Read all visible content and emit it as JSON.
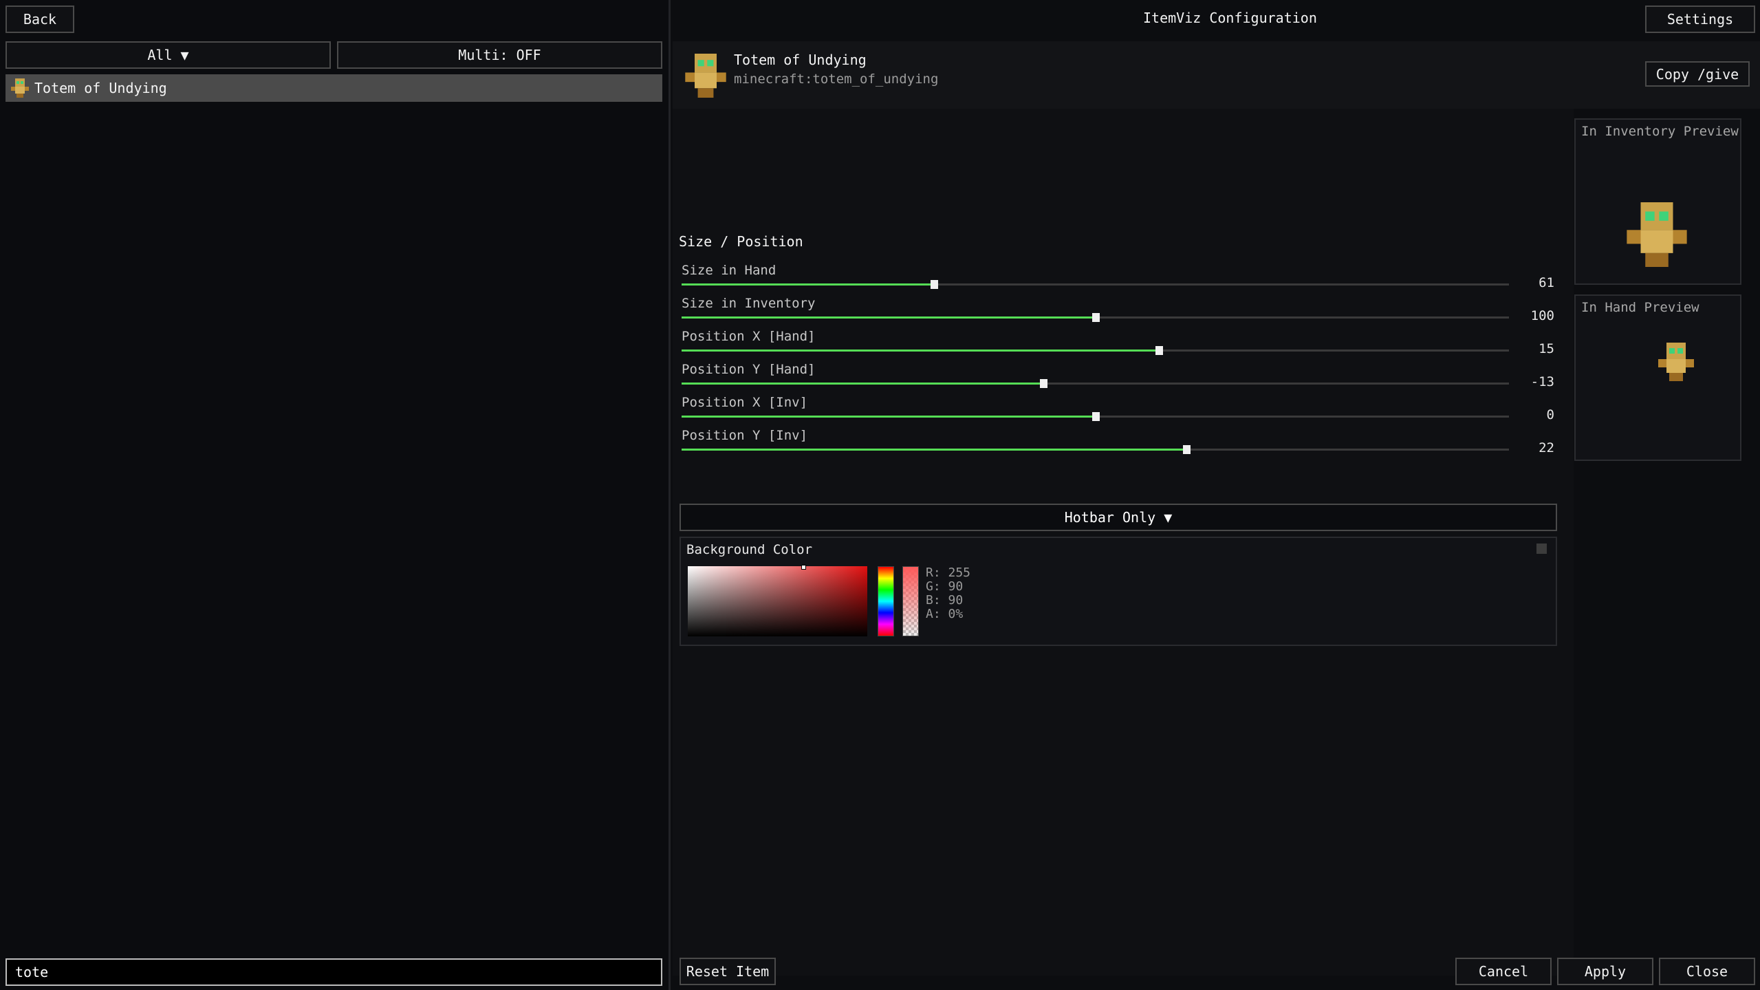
{
  "left_panel": {
    "back_label": "Back",
    "filter_label": "All ▼",
    "multi_label": "Multi: OFF",
    "items": [
      {
        "label": "Totem of Undying",
        "icon": "totem-icon"
      }
    ],
    "search_value": "tote"
  },
  "header": {
    "title": "ItemViz Configuration",
    "settings_label": "Settings"
  },
  "item": {
    "name": "Totem of Undying",
    "id": "minecraft:totem_of_undying",
    "copy_give_label": "Copy /give"
  },
  "size_position": {
    "section_title": "Size / Position",
    "sliders": [
      {
        "label": "Size in Hand",
        "value": "61",
        "fill_fraction": 0.305
      },
      {
        "label": "Size in Inventory",
        "value": "100",
        "fill_fraction": 0.5
      },
      {
        "label": "Position X [Hand]",
        "value": "15",
        "fill_fraction": 0.577
      },
      {
        "label": "Position Y [Hand]",
        "value": "-13",
        "fill_fraction": 0.437
      },
      {
        "label": "Position X [Inv]",
        "value": "0",
        "fill_fraction": 0.5
      },
      {
        "label": "Position Y [Inv]",
        "value": "22",
        "fill_fraction": 0.61
      }
    ]
  },
  "previews": {
    "inventory_label": "In Inventory Preview",
    "hand_label": "In Hand Preview"
  },
  "display_mode": {
    "selected": "Hotbar Only ▼"
  },
  "background_color": {
    "title": "Background Color",
    "r": "R: 255",
    "g": "G: 90",
    "b": "B: 90",
    "a": "A: 0%"
  },
  "footer": {
    "reset_label": "Reset Item",
    "cancel_label": "Cancel",
    "apply_label": "Apply",
    "close_label": "Close"
  },
  "colors": {
    "slider_fill": "#55dd55",
    "list_highlight": "#4b4b4b",
    "picker_hue": "#e31010"
  }
}
